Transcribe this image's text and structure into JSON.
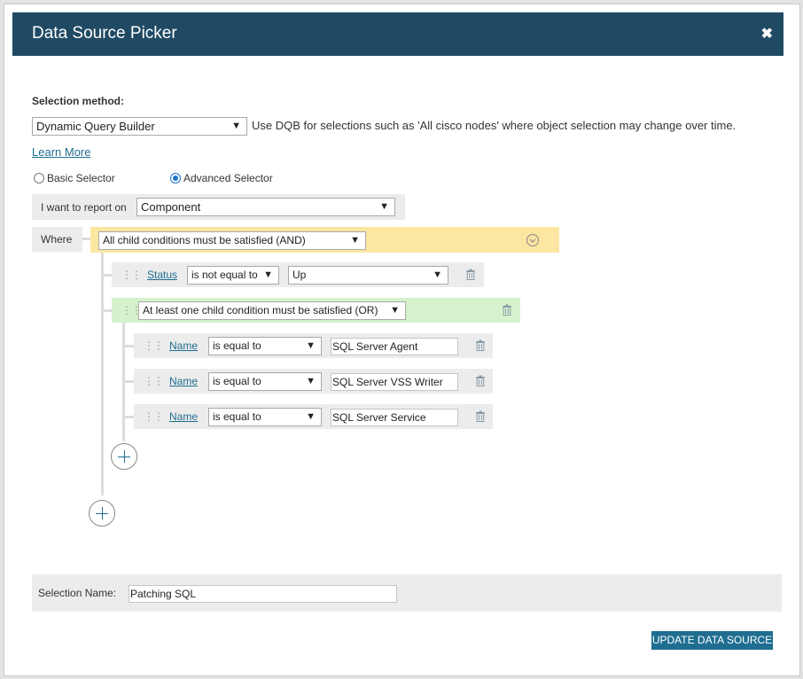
{
  "dialog": {
    "title": "Data Source Picker",
    "close_glyph": "✖"
  },
  "selection_method": {
    "label": "Selection method:",
    "value": "Dynamic Query Builder",
    "hint": "Use DQB for selections such as 'All cisco nodes' where object selection may change over time.",
    "learn_more": "Learn More"
  },
  "selector": {
    "basic_label": "Basic Selector",
    "advanced_label": "Advanced Selector",
    "selected": "Advanced Selector"
  },
  "report_on": {
    "label": "I want to report on",
    "value": "Component"
  },
  "where": {
    "label": "Where",
    "root_condition": "All child conditions must be satisfied (AND)",
    "status_rule": {
      "field": "Status",
      "operator": "is not equal to",
      "value": "Up"
    },
    "group_condition": "At least one child condition must be satisfied (OR)",
    "group_rules": [
      {
        "field": "Name",
        "operator": "is equal to",
        "value": "SQL Server Agent"
      },
      {
        "field": "Name",
        "operator": "is equal to",
        "value": "SQL Server VSS Writer"
      },
      {
        "field": "Name",
        "operator": "is equal to",
        "value": "SQL Server Service"
      }
    ]
  },
  "selection_name": {
    "label": "Selection Name:",
    "value": "Patching SQL"
  },
  "update_button": "UPDATE DATA SOURCE",
  "colors": {
    "titlebar": "#204a64",
    "and_group": "#fbe6a2",
    "or_group": "#d6f2cc",
    "button": "#1f6e91"
  }
}
